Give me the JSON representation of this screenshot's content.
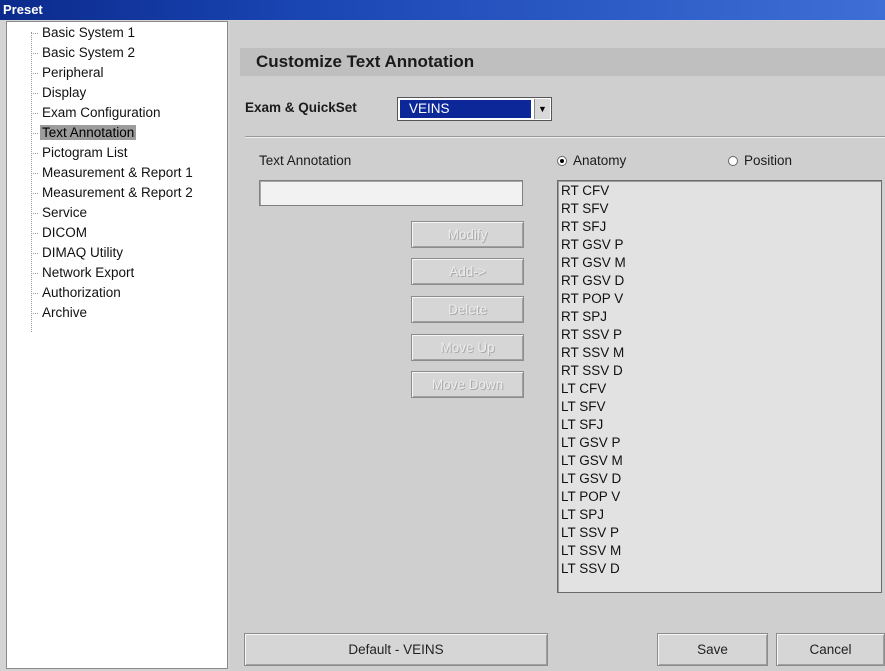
{
  "window": {
    "title": "Preset"
  },
  "tree": {
    "items": [
      {
        "label": "Basic System 1",
        "selected": false
      },
      {
        "label": "Basic System 2",
        "selected": false
      },
      {
        "label": "Peripheral",
        "selected": false
      },
      {
        "label": "Display",
        "selected": false
      },
      {
        "label": "Exam Configuration",
        "selected": false
      },
      {
        "label": "Text Annotation",
        "selected": true
      },
      {
        "label": "Pictogram List",
        "selected": false
      },
      {
        "label": "Measurement & Report 1",
        "selected": false
      },
      {
        "label": "Measurement & Report 2",
        "selected": false
      },
      {
        "label": "Service",
        "selected": false
      },
      {
        "label": "DICOM",
        "selected": false
      },
      {
        "label": "DIMAQ Utility",
        "selected": false
      },
      {
        "label": "Network Export",
        "selected": false
      },
      {
        "label": "Authorization",
        "selected": false
      },
      {
        "label": "Archive",
        "selected": false
      }
    ]
  },
  "panel": {
    "title": "Customize Text Annotation",
    "exam_label": "Exam & QuickSet",
    "exam_value": "VEINS",
    "text_annotation_label": "Text Annotation",
    "text_annotation_value": "",
    "buttons": {
      "modify": "Modify",
      "add": "Add->",
      "delete": "Delete",
      "move_up": "Move Up",
      "move_down": "Move Down"
    },
    "radio": {
      "anatomy": "Anatomy",
      "position": "Position",
      "selected": "anatomy"
    },
    "list": [
      "RT CFV",
      "RT SFV",
      "RT SFJ",
      "RT GSV P",
      "RT GSV M",
      "RT GSV D",
      "RT POP V",
      "RT SPJ",
      "RT SSV P",
      "RT SSV M",
      "RT SSV D",
      "LT CFV",
      "LT SFV",
      "LT SFJ",
      "LT GSV P",
      "LT GSV M",
      "LT GSV D",
      "LT POP V",
      "LT SPJ",
      "LT SSV P",
      "LT SSV M",
      "LT SSV D"
    ],
    "footer": {
      "default": "Default - VEINS",
      "save": "Save",
      "cancel": "Cancel"
    }
  }
}
